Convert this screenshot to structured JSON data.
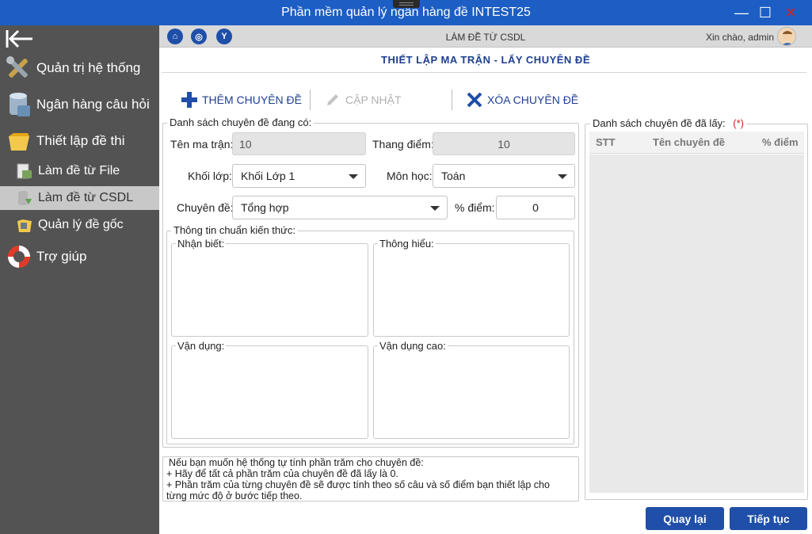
{
  "app": {
    "title": "Phần mềm quản lý ngân hàng đề INTEST25",
    "controls": {
      "minimize": "—",
      "maximize": "☐",
      "close": "✕"
    }
  },
  "sidebar": {
    "items": [
      {
        "label": "Quản trị hệ thống",
        "icon": "tools-icon"
      },
      {
        "label": "Ngân hàng câu hỏi",
        "icon": "database-icon"
      },
      {
        "label": "Thiết lập đề thi",
        "icon": "folder-icon"
      },
      {
        "label": "Làm đề từ File",
        "icon": "file-import-icon"
      },
      {
        "label": "Làm đề từ CSDL",
        "icon": "db-export-icon",
        "active": true
      },
      {
        "label": "Quản lý đề gốc",
        "icon": "folder-manage-icon"
      },
      {
        "label": "Trợ giúp",
        "icon": "lifebuoy-icon"
      }
    ]
  },
  "header": {
    "caption": "LÀM ĐỀ TỪ CSDL",
    "greeting": "Xin chào, admin",
    "icons": {
      "home": "⌂",
      "help": "◎",
      "info": "Y"
    }
  },
  "section_title": "THIẾT LẬP MA TRẬN - LẤY CHUYÊN ĐỀ",
  "toolbar": {
    "add_label": "THÊM CHUYÊN ĐỀ",
    "update_label": "CẬP NHẬT",
    "delete_label": "XÓA CHUYÊN ĐỀ"
  },
  "form": {
    "legend": "Danh sách chuyên đề đang có:",
    "matrix_name_label": "Tên ma trận:",
    "matrix_name_value": "10",
    "score_scale_label": "Thang điểm:",
    "score_scale_value": "10",
    "grade_label": "Khối lớp:",
    "grade_value": "Khối Lớp 1",
    "subject_label": "Môn học:",
    "subject_value": "Toán",
    "topic_label": "Chuyên đề:",
    "topic_value": "Tổng hợp",
    "percent_label": "% điểm:",
    "percent_value": "0",
    "standards_legend": "Thông tin chuẩn kiến thức:",
    "recognize_label": "Nhận biết:",
    "understand_label": "Thông hiểu:",
    "apply_label": "Vận dụng:",
    "apply_high_label": "Vận dụng cao:"
  },
  "note": {
    "line1": "Nếu bạn muốn hệ thống tự tính phần trăm cho chuyên đề:",
    "line2": "+ Hãy để tất cả phần trăm của chuyên đề đã lấy là 0.",
    "line3": "+ Phần trăm của từng chuyên đề sẽ được tính theo số câu và số điểm bạn thiết lập cho",
    "line4": "từng mức độ ở bước tiếp theo."
  },
  "selected": {
    "legend": "Danh sách chuyên đề đã lấy:",
    "required_mark": "(*)",
    "columns": [
      "STT",
      "Tên chuyên đề",
      "% điểm"
    ],
    "rows": []
  },
  "buttons": {
    "back": "Quay lại",
    "next": "Tiếp tục"
  },
  "colors": {
    "title_bar": "#1c5ec4",
    "sidebar": "#535353",
    "accent": "#1f4fa8",
    "danger": "#d62020"
  }
}
